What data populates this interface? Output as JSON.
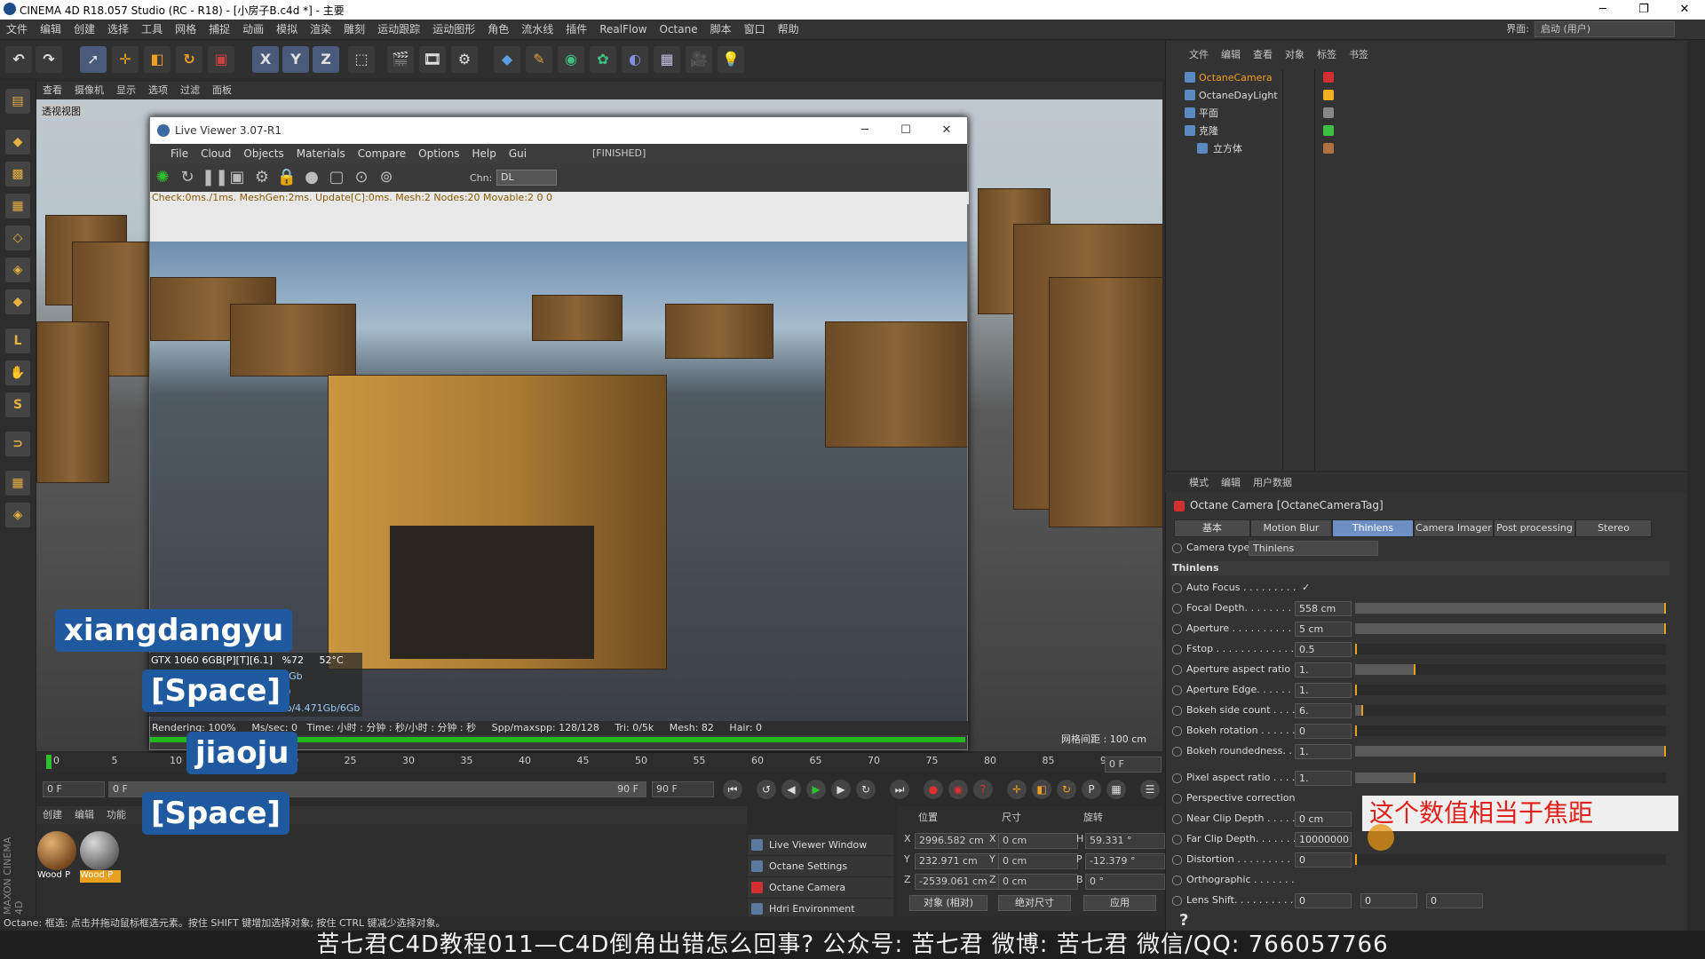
{
  "window": {
    "title": "CINEMA 4D R18.057 Studio (RC - R18) - [小房子B.c4d *] - 主要",
    "min": "─",
    "max": "❐",
    "close": "✕"
  },
  "menubar": {
    "items": [
      "文件",
      "编辑",
      "创建",
      "选择",
      "工具",
      "网格",
      "捕捉",
      "动画",
      "模拟",
      "渲染",
      "雕刻",
      "运动跟踪",
      "运动图形",
      "角色",
      "流水线",
      "插件",
      "RealFlow",
      "Octane",
      "脚本",
      "窗口",
      "帮助"
    ],
    "layout_label": "界面:",
    "layout_value": "启动 (用户)"
  },
  "toolbar": {
    "x": "X",
    "y": "Y",
    "z": "Z"
  },
  "viewport": {
    "menu": [
      "查看",
      "摄像机",
      "显示",
      "选项",
      "过滤",
      "面板"
    ],
    "label": "透视视图",
    "grid_info": "网格间距 : 100 cm"
  },
  "live_viewer": {
    "title": "Live Viewer 3.07-R1",
    "menu": [
      "File",
      "Cloud",
      "Objects",
      "Materials",
      "Compare",
      "Options",
      "Help",
      "Gui"
    ],
    "status": "[FINISHED]",
    "chn_label": "Chn:",
    "chn_value": "DL",
    "info": "Check:0ms./1ms. MeshGen:2ms. Update[C]:0ms. Mesh:2 Nodes:20 Movable:2  0 0",
    "gpu": {
      "name": "GTX 1060 6GB[P][T][6.1]",
      "pct": "%72",
      "temp": "52°C"
    },
    "gpu_lines": [
      "Out-of-core used/max:0Kb/4Gb",
      "Grey8/16: 0/0    Rgb32/64: 4/0",
      "Used/free/total vram: 274Mb/4.471Gb/6Gb"
    ],
    "stats": {
      "rendering": "Rendering: 100%",
      "mssec": "Ms/sec: 0",
      "time": "Time: 小时 : 分钟 : 秒/小时 : 分钟 : 秒",
      "spp": "Spp/maxspp: 128/128",
      "tri": "Tri: 0/5k",
      "mesh": "Mesh: 82",
      "hair": "Hair: 0"
    },
    "progress": 1.0
  },
  "timeline": {
    "ticks": [
      "0",
      "5",
      "10",
      "15",
      "20",
      "25",
      "30",
      "35",
      "40",
      "45",
      "50",
      "55",
      "60",
      "65",
      "70",
      "75",
      "80",
      "85",
      "90"
    ],
    "current_frame": "0 F",
    "start": "0 F",
    "range_start": "0 F",
    "range_end": "90 F",
    "end": "90 F"
  },
  "materials": {
    "menu": [
      "创建",
      "编辑",
      "功能"
    ],
    "items": [
      "Wood P",
      "Wood P"
    ]
  },
  "octane_list": [
    "Live Viewer Window",
    "Octane Settings",
    "Octane Camera",
    "Hdri Environment"
  ],
  "coords": {
    "headers": [
      "位置",
      "尺寸",
      "旋转"
    ],
    "rows": [
      {
        "pl": "X",
        "pos": "2996.582 cm",
        "sl": "X",
        "size": "0 cm",
        "rl": "H",
        "rot": "59.331 °"
      },
      {
        "pl": "Y",
        "pos": "232.971 cm",
        "sl": "Y",
        "size": "0 cm",
        "rl": "P",
        "rot": "-12.379 °"
      },
      {
        "pl": "Z",
        "pos": "-2539.061 cm",
        "sl": "Z",
        "size": "0 cm",
        "rl": "B",
        "rot": "0 °"
      }
    ],
    "mode": "对象 (相对)",
    "size_mode": "绝对尺寸",
    "apply": "应用"
  },
  "statusbar": {
    "text": "Octane:     框选: 点击并拖动鼠标框选元素。按住 SHIFT 键增加选择对象; 按住 CTRL 键减少选择对象。"
  },
  "caption": "苦七君C4D教程011—C4D倒角出错怎么回事?    公众号: 苦七君    微博: 苦七君    微信/QQ: 766057766",
  "object_manager": {
    "menu": [
      "文件",
      "编辑",
      "查看",
      "对象",
      "标签",
      "书签"
    ],
    "objects": [
      "OctaneCamera",
      "OctaneDayLight",
      "平面",
      "克隆",
      "立方体"
    ]
  },
  "attribute_manager": {
    "menu": [
      "模式",
      "编辑",
      "用户数据"
    ],
    "title": "Octane Camera [OctaneCameraTag]",
    "tabs": [
      "基本",
      "Motion Blur",
      "Thinlens",
      "Camera Imager",
      "Post processing",
      "Stereo"
    ],
    "active_tab": "Thinlens",
    "camera_type_label": "Camera type",
    "camera_type_value": "Thinlens",
    "section": "Thinlens",
    "fields": [
      {
        "label": "Auto Focus . . . . . . . . .",
        "value": "✓",
        "fill": null
      },
      {
        "label": "Focal Depth. . . . . . . .",
        "value": "558 cm",
        "fill": 1.0
      },
      {
        "label": "Aperture . . . . . . . . . . .",
        "value": "5 cm",
        "fill": 1.0
      },
      {
        "label": "Fstop . . . . . . . . . . . . .",
        "value": "0.5",
        "fill": 0.0
      },
      {
        "label": "Aperture aspect ratio",
        "value": "1.",
        "fill": 0.19
      },
      {
        "label": "Aperture Edge. . . . . . .",
        "value": "1.",
        "fill": 0.0
      },
      {
        "label": "Bokeh side count . . . .",
        "value": "6.",
        "fill": 0.02
      },
      {
        "label": "Bokeh rotation . . . . . .",
        "value": "0",
        "fill": 0.0
      },
      {
        "label": "Bokeh roundedness. . .",
        "value": "1.",
        "fill": 1.0
      },
      {
        "label": "Pixel aspect ratio . . . .",
        "value": "1.",
        "fill": 0.19
      },
      {
        "label": "Perspective correction",
        "value": "",
        "fill": null
      },
      {
        "label": "Near Clip Depth . . . . .",
        "value": "0 cm",
        "fill": null
      },
      {
        "label": "Far Clip Depth. . . . . . .",
        "value": "10000000",
        "fill": null
      },
      {
        "label": "Distortion . . . . . . . . .",
        "value": "0",
        "fill": 0.0
      },
      {
        "label": "Orthographic . . . . . . .",
        "value": "",
        "fill": null
      },
      {
        "label": "Lens Shift. . . . . . . . . .",
        "value": "0",
        "fill": null
      }
    ],
    "lens_shift_extra": [
      "0",
      "0"
    ]
  },
  "overlays": {
    "keys": [
      "xiangdangyu",
      "[Space]",
      "jiaoju",
      "[Space]"
    ],
    "hint": "这个数值相当于焦距"
  },
  "logo": "MAXON CINEMA 4D",
  "colors": {
    "accent": "#6d8fc4",
    "progress": "#1fb81f",
    "key_bg": "#1f5aa0",
    "hint_text": "#e0201a"
  }
}
